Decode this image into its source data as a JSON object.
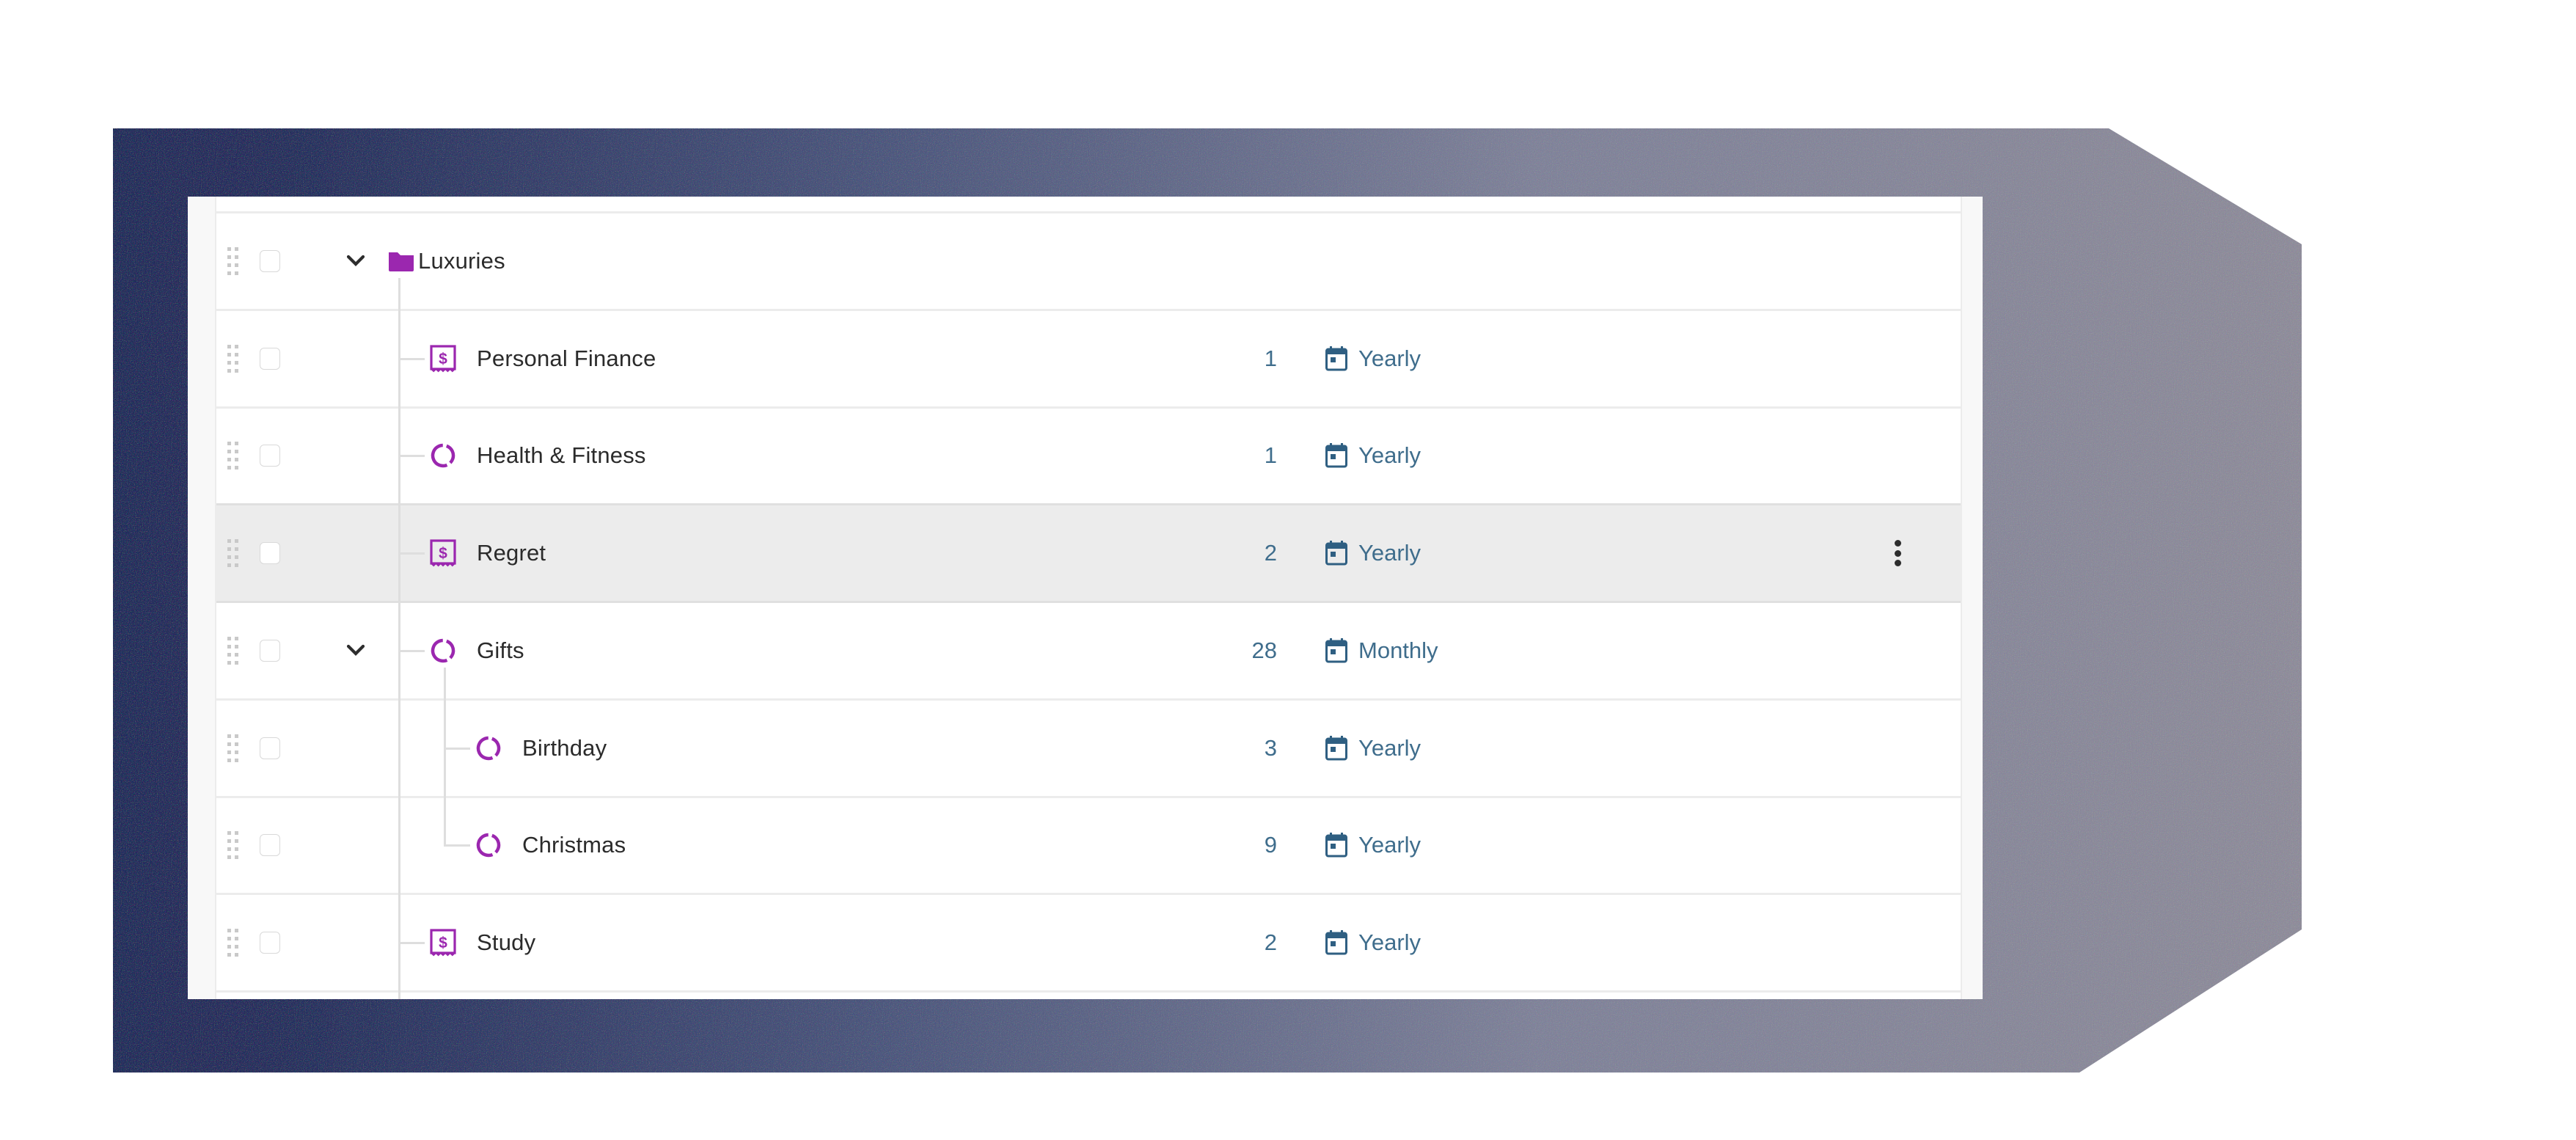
{
  "colors": {
    "accent_purple": "#9b27af",
    "link_blue": "#3f6d8c",
    "calendar_blue": "#2f5f82",
    "text_dark": "#2b2b2b",
    "row_highlight": "#ececec",
    "bg_gradient_start": "#1f2a5a",
    "bg_gradient_end": "#8e8c9a"
  },
  "table": {
    "rows": [
      {
        "name": "Luxuries",
        "type": "folder",
        "icon": "folder-icon",
        "level": 0,
        "expanded": true,
        "count": "",
        "frequency": "",
        "highlighted": false
      },
      {
        "name": "Personal Finance",
        "type": "receipt",
        "icon": "receipt-dollar-icon",
        "level": 1,
        "expanded": false,
        "count": "1",
        "frequency": "Yearly",
        "highlighted": false
      },
      {
        "name": "Health & Fitness",
        "type": "ring",
        "icon": "progress-ring-icon",
        "level": 1,
        "expanded": false,
        "count": "1",
        "frequency": "Yearly",
        "highlighted": false
      },
      {
        "name": "Regret",
        "type": "receipt",
        "icon": "receipt-dollar-icon",
        "level": 1,
        "expanded": false,
        "count": "2",
        "frequency": "Yearly",
        "highlighted": true,
        "show_menu": true
      },
      {
        "name": "Gifts",
        "type": "ring",
        "icon": "progress-ring-icon",
        "level": 1,
        "expanded": true,
        "count": "28",
        "frequency": "Monthly",
        "highlighted": false
      },
      {
        "name": "Birthday",
        "type": "ring",
        "icon": "progress-ring-icon",
        "level": 2,
        "expanded": false,
        "count": "3",
        "frequency": "Yearly",
        "highlighted": false
      },
      {
        "name": "Christmas",
        "type": "ring",
        "icon": "progress-ring-icon",
        "level": 2,
        "expanded": false,
        "count": "9",
        "frequency": "Yearly",
        "highlighted": false
      },
      {
        "name": "Study",
        "type": "receipt",
        "icon": "receipt-dollar-icon",
        "level": 1,
        "expanded": false,
        "count": "2",
        "frequency": "Yearly",
        "highlighted": false
      }
    ]
  }
}
